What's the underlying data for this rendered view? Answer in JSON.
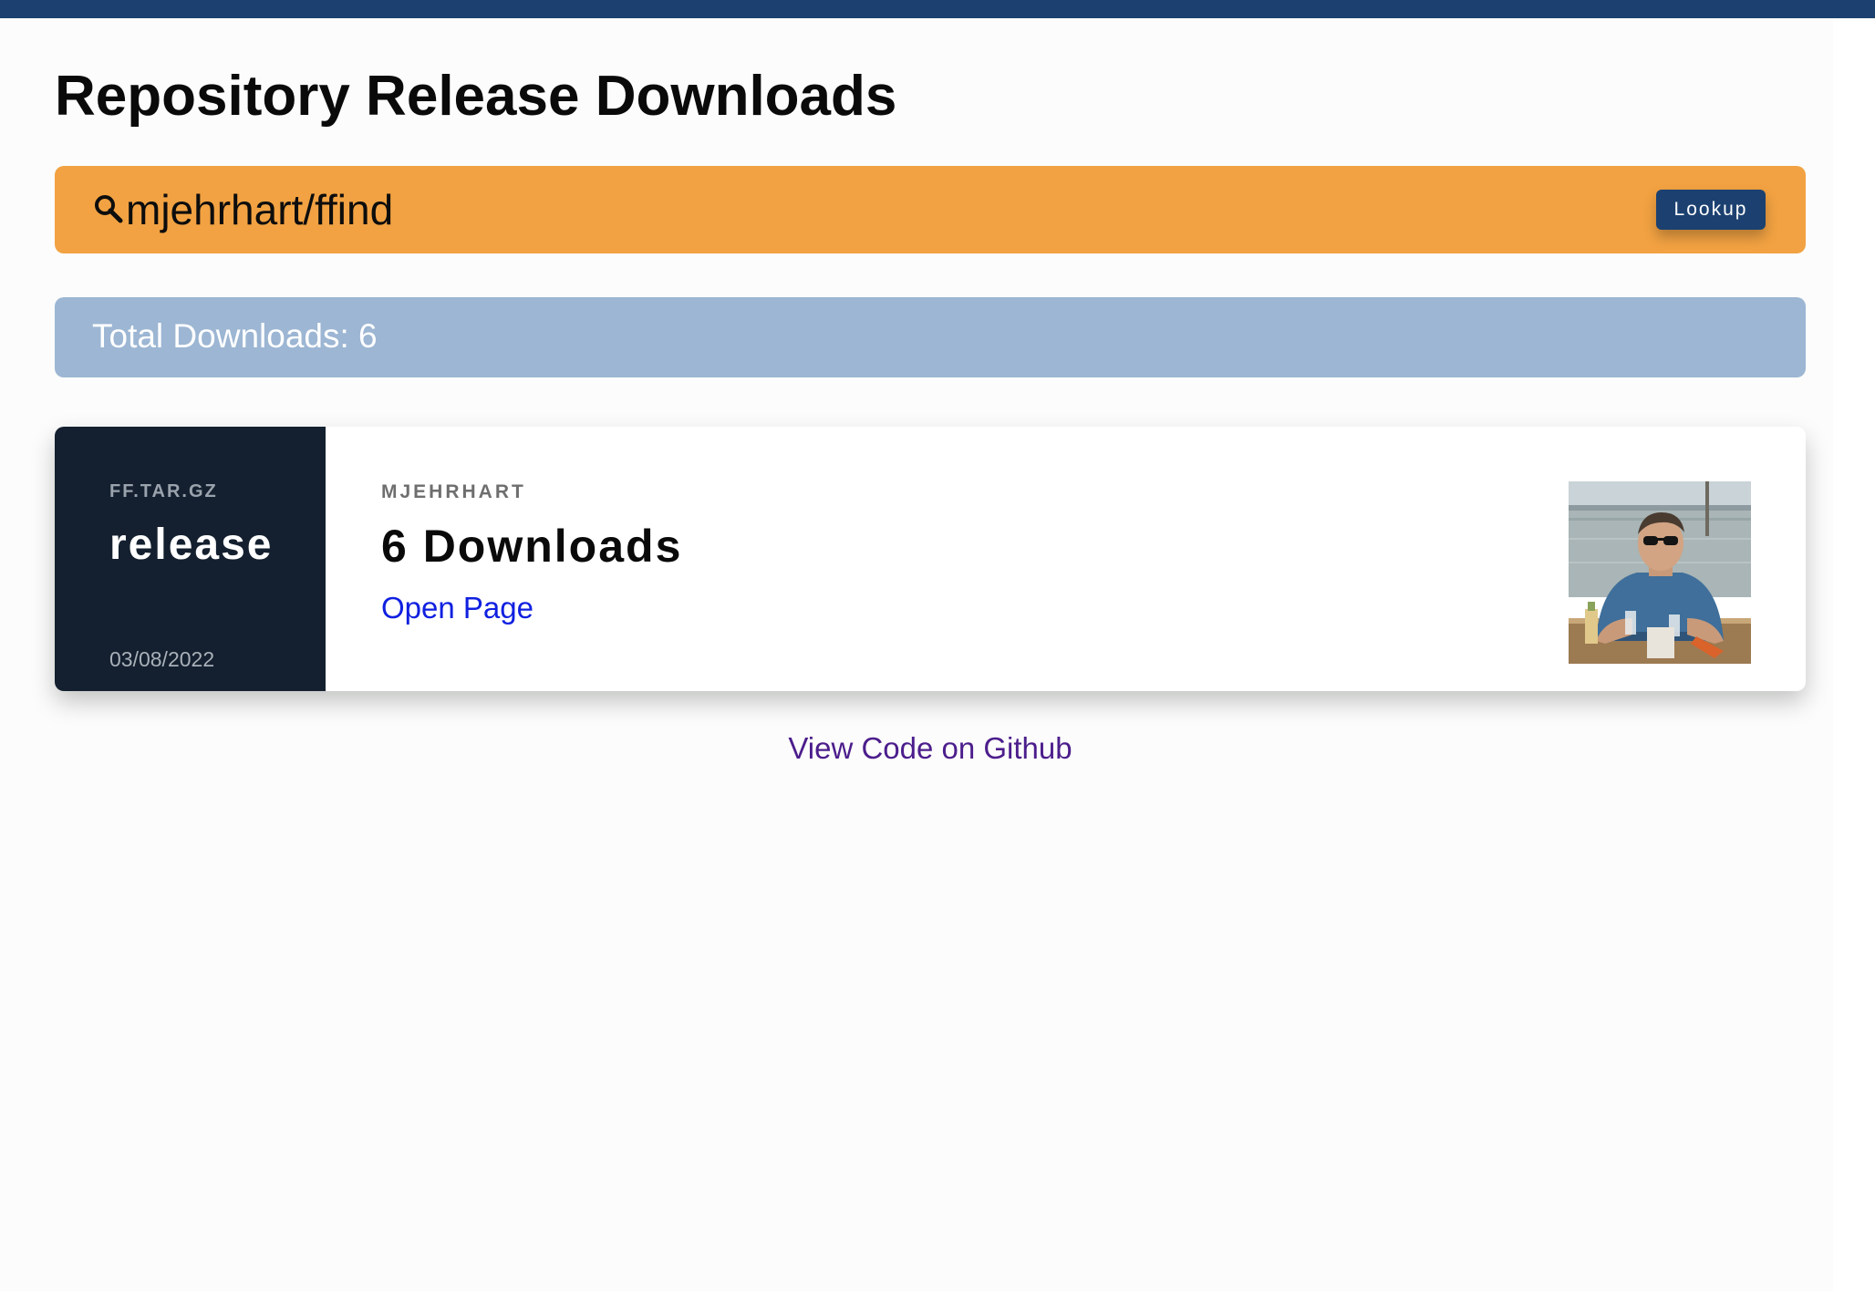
{
  "header": {
    "title": "Repository Release Downloads",
    "accent_color": "#1c4170"
  },
  "search": {
    "value": "mjehrhart/ffind",
    "icon": "search-icon",
    "button_label": "Lookup",
    "bar_color": "#f2a242"
  },
  "summary": {
    "total_downloads_text": "Total Downloads: 6",
    "bar_color": "#9cb6d3"
  },
  "releases": [
    {
      "asset_name": "FF.TAR.GZ",
      "release_name": "release",
      "date": "03/08/2022",
      "author": "MJEHRHART",
      "downloads_text": "6 Downloads",
      "link_label": "Open Page",
      "avatar": "author-avatar-photo"
    }
  ],
  "footer": {
    "link_label": "View Code on Github"
  }
}
